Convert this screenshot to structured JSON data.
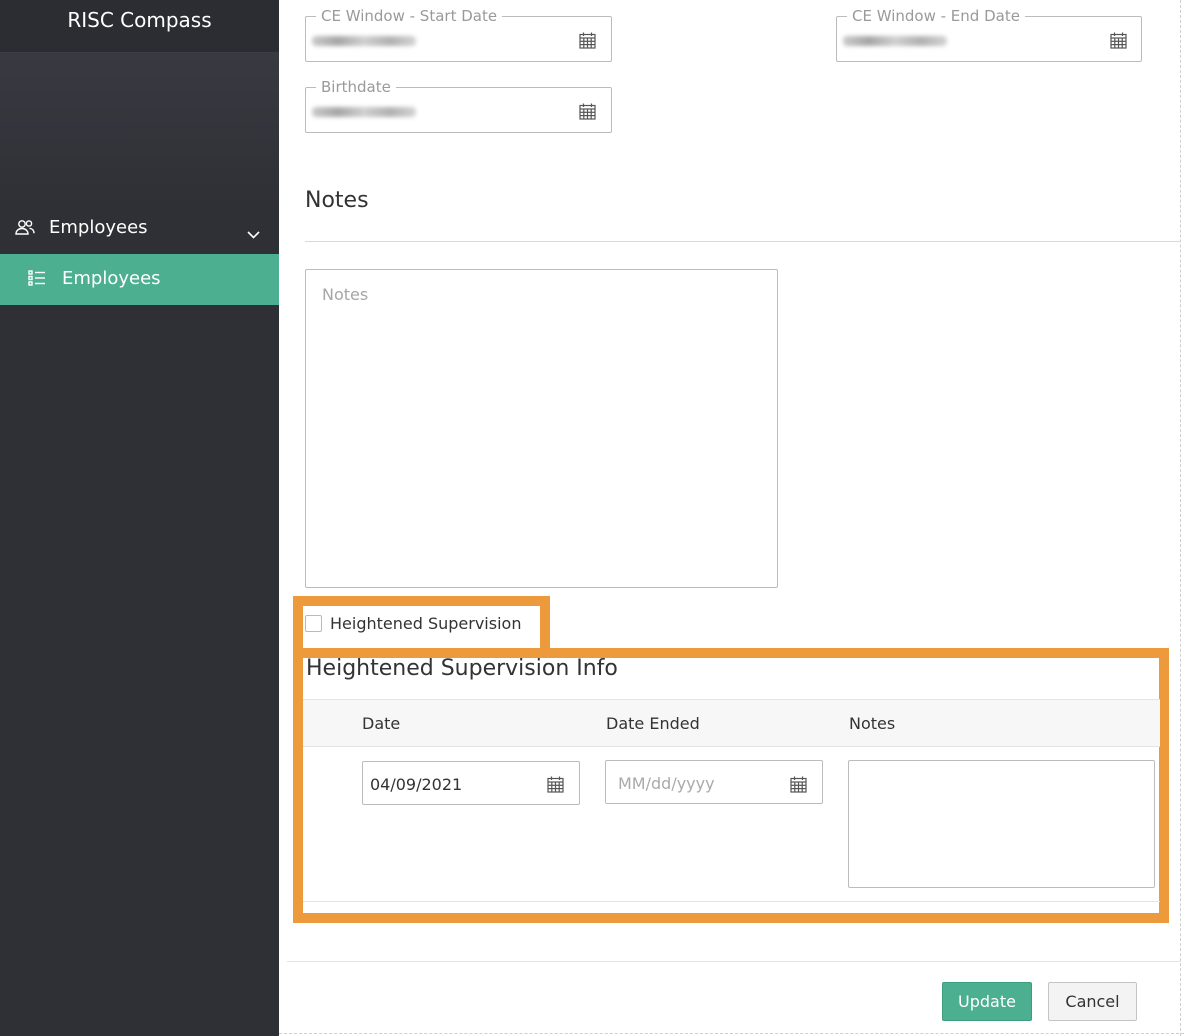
{
  "app": {
    "title": "RISC Compass"
  },
  "sidebar": {
    "group_label": "Employees",
    "active_item_label": "Employees"
  },
  "fields": {
    "ce_start_label": "CE Window - Start Date",
    "ce_end_label": "CE Window - End Date",
    "birthdate_label": "Birthdate"
  },
  "notes": {
    "section_title": "Notes",
    "placeholder": "Notes"
  },
  "supervision": {
    "checkbox_label": "Heightened Supervision",
    "checked": false,
    "info_title": "Heightened Supervision Info",
    "columns": [
      "Date",
      "Date Ended",
      "Notes"
    ],
    "row": {
      "date_value": "04/09/2021",
      "date_ended_placeholder": "MM/dd/yyyy",
      "notes_value": ""
    }
  },
  "actions": {
    "update_label": "Update",
    "cancel_label": "Cancel"
  },
  "colors": {
    "sidebar_bg": "#2f3036",
    "accent_green": "#4caf8f",
    "highlight_orange": "#ec9a3b"
  }
}
